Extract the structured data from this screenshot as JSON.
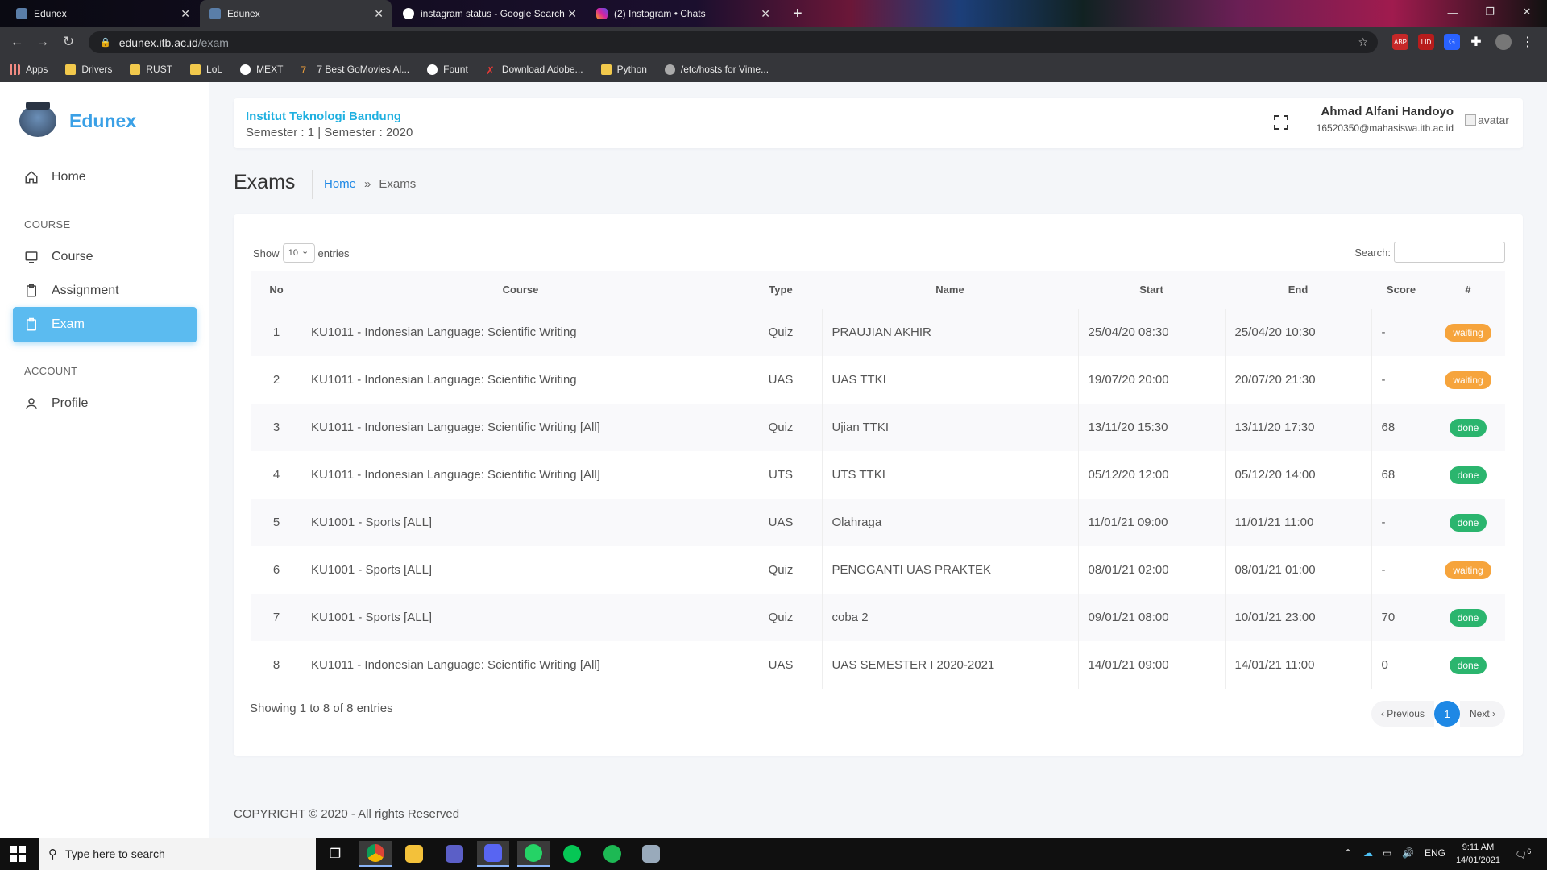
{
  "browser": {
    "tabs": [
      {
        "title": "Edunex",
        "active": false
      },
      {
        "title": "Edunex",
        "active": true
      },
      {
        "title": "instagram status - Google Search",
        "active": false
      },
      {
        "title": "(2) Instagram • Chats",
        "active": false
      }
    ],
    "url_host": "edunex.itb.ac.id",
    "url_path": "/exam",
    "bookmarks": [
      "Apps",
      "Drivers",
      "RUST",
      "LoL",
      "MEXT",
      "7 Best GoMovies Al...",
      "Fount",
      "Download Adobe...",
      "Python",
      "/etc/hosts for Vime..."
    ],
    "extensions": [
      "ABP",
      "LID"
    ]
  },
  "sidebar": {
    "brand": "Edunex",
    "home": "Home",
    "course_heading": "COURSE",
    "course": "Course",
    "assignment": "Assignment",
    "exam": "Exam",
    "account_heading": "ACCOUNT",
    "profile": "Profile"
  },
  "header": {
    "institution": "Institut Teknologi Bandung",
    "semester": "Semester : 1 | Semester : 2020",
    "user_name": "Ahmad Alfani Handoyo",
    "user_email": "16520350@mahasiswa.itb.ac.id",
    "avatar_alt": "avatar"
  },
  "page": {
    "title": "Exams",
    "breadcrumb_home": "Home",
    "breadcrumb_sep": "»",
    "breadcrumb_current": "Exams"
  },
  "table": {
    "show_label": "Show",
    "entries_value": "10",
    "entries_label": "entries",
    "search_label": "Search:",
    "columns": [
      "No",
      "Course",
      "Type",
      "Name",
      "Start",
      "End",
      "Score",
      "#"
    ],
    "rows": [
      {
        "no": "1",
        "course": "KU1011 - Indonesian Language: Scientific Writing",
        "type": "Quiz",
        "name": "PRAUJIAN AKHIR",
        "start": "25/04/20 08:30",
        "end": "25/04/20 10:30",
        "score": "-",
        "status": "waiting"
      },
      {
        "no": "2",
        "course": "KU1011 - Indonesian Language: Scientific Writing",
        "type": "UAS",
        "name": "UAS TTKI",
        "start": "19/07/20 20:00",
        "end": "20/07/20 21:30",
        "score": "-",
        "status": "waiting"
      },
      {
        "no": "3",
        "course": "KU1011 - Indonesian Language: Scientific Writing [All]",
        "type": "Quiz",
        "name": "Ujian TTKI",
        "start": "13/11/20 15:30",
        "end": "13/11/20 17:30",
        "score": "68",
        "status": "done"
      },
      {
        "no": "4",
        "course": "KU1011 - Indonesian Language: Scientific Writing [All]",
        "type": "UTS",
        "name": "UTS TTKI",
        "start": "05/12/20 12:00",
        "end": "05/12/20 14:00",
        "score": "68",
        "status": "done"
      },
      {
        "no": "5",
        "course": "KU1001 - Sports [ALL]",
        "type": "UAS",
        "name": "Olahraga",
        "start": "11/01/21 09:00",
        "end": "11/01/21 11:00",
        "score": "-",
        "status": "done"
      },
      {
        "no": "6",
        "course": "KU1001 - Sports [ALL]",
        "type": "Quiz",
        "name": "PENGGANTI UAS PRAKTEK",
        "start": "08/01/21 02:00",
        "end": "08/01/21 01:00",
        "score": "-",
        "status": "waiting"
      },
      {
        "no": "7",
        "course": "KU1001 - Sports [ALL]",
        "type": "Quiz",
        "name": "coba 2",
        "start": "09/01/21 08:00",
        "end": "10/01/21 23:00",
        "score": "70",
        "status": "done"
      },
      {
        "no": "8",
        "course": "KU1011 - Indonesian Language: Scientific Writing [All]",
        "type": "UAS",
        "name": "UAS SEMESTER I 2020-2021",
        "start": "14/01/21 09:00",
        "end": "14/01/21 11:00",
        "score": "0",
        "status": "done"
      }
    ],
    "showing": "Showing 1 to 8 of 8 entries",
    "prev": "‹ Previous",
    "page": "1",
    "next": "Next ›"
  },
  "footer": "COPYRIGHT © 2020 - All rights Reserved",
  "taskbar": {
    "search_placeholder": "Type here to search",
    "lang": "ENG",
    "time": "9:11 AM",
    "date": "14/01/2021",
    "notif_count": "6"
  },
  "colors": {
    "accent": "#5bbbf0",
    "brand": "#3aa0e6",
    "waiting": "#f6a43c",
    "done": "#2bb56e",
    "link": "#1e88e5"
  }
}
